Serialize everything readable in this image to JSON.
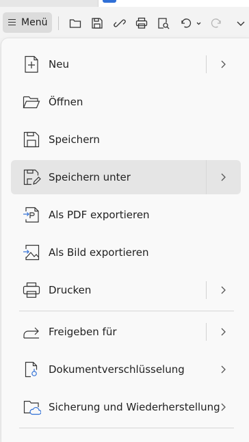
{
  "toolbar": {
    "menu_label": "Menü",
    "icons": [
      "open-folder-icon",
      "save-icon",
      "link-icon",
      "print-icon",
      "print-preview-icon",
      "undo-icon",
      "redo-icon",
      "more-chevron-icon"
    ]
  },
  "menu": {
    "items": [
      {
        "label": "Neu",
        "icon": "new-document-icon",
        "submenu": true,
        "split": true
      },
      {
        "label": "Öffnen",
        "icon": "open-folder-icon",
        "submenu": false
      },
      {
        "label": "Speichern",
        "icon": "save-icon",
        "submenu": false
      },
      {
        "label": "Speichern unter",
        "icon": "save-as-icon",
        "submenu": true,
        "split": true,
        "active": true
      },
      {
        "label": "Als PDF exportieren",
        "icon": "export-pdf-icon",
        "submenu": false
      },
      {
        "label": "Als Bild exportieren",
        "icon": "export-image-icon",
        "submenu": false
      },
      {
        "label": "Drucken",
        "icon": "print-icon",
        "submenu": true,
        "split": true
      },
      {
        "label": "Freigeben für",
        "icon": "share-icon",
        "submenu": true,
        "split": true
      },
      {
        "label": "Dokumentverschlüsselung",
        "icon": "document-encryption-icon",
        "submenu": true
      },
      {
        "label": "Sicherung und Wiederherstellung",
        "icon": "backup-restore-icon",
        "submenu": true
      }
    ]
  },
  "colors": {
    "panel_bg": "#f9f9f9",
    "active_item_bg": "#e5e5e5",
    "toolbar_bg": "#f3f3f3",
    "accent": "#2f6fd6",
    "cloud_blue": "#2f6fd6"
  }
}
